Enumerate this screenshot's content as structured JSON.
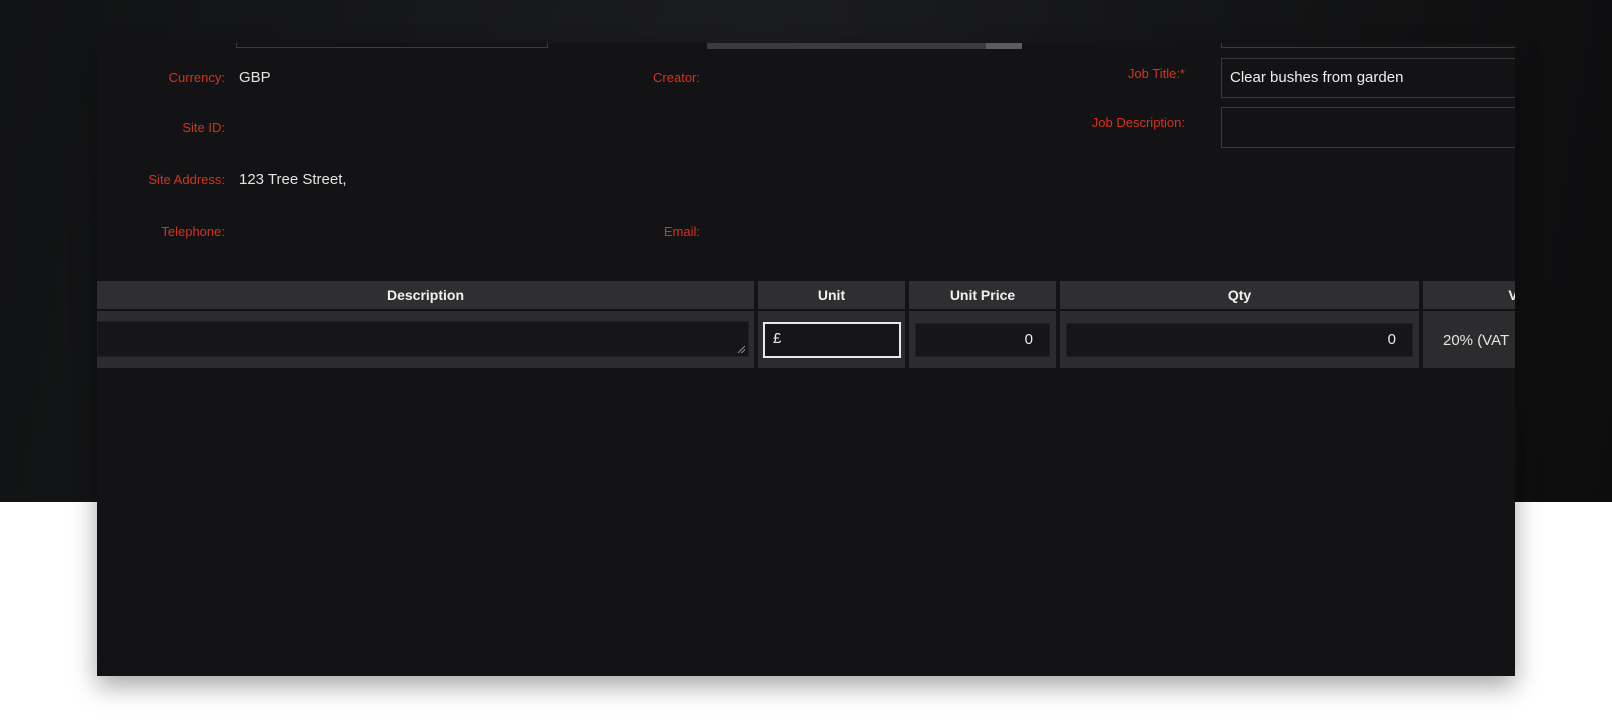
{
  "labels": {
    "currency": "Currency:",
    "creator": "Creator:",
    "job_title": "Job Title:*",
    "job_description": "Job Description:",
    "site_id": "Site ID:",
    "site_address": "Site Address:",
    "telephone": "Telephone:",
    "email": "Email:"
  },
  "values": {
    "currency": "GBP",
    "site_address": "123 Tree Street,"
  },
  "inputs": {
    "job_title": "Clear bushes from garden",
    "job_description": ""
  },
  "table": {
    "headers": {
      "description": "Description",
      "unit": "Unit",
      "unit_price": "Unit Price",
      "qty": "Qty",
      "vat": "V"
    },
    "row": {
      "description": "",
      "unit": "£",
      "unit_price": "0",
      "qty": "0",
      "vat": "20% (VAT"
    }
  },
  "colors": {
    "label": "#d6321e",
    "panel_bg": "#131315",
    "header_bg": "#2f2f31"
  }
}
